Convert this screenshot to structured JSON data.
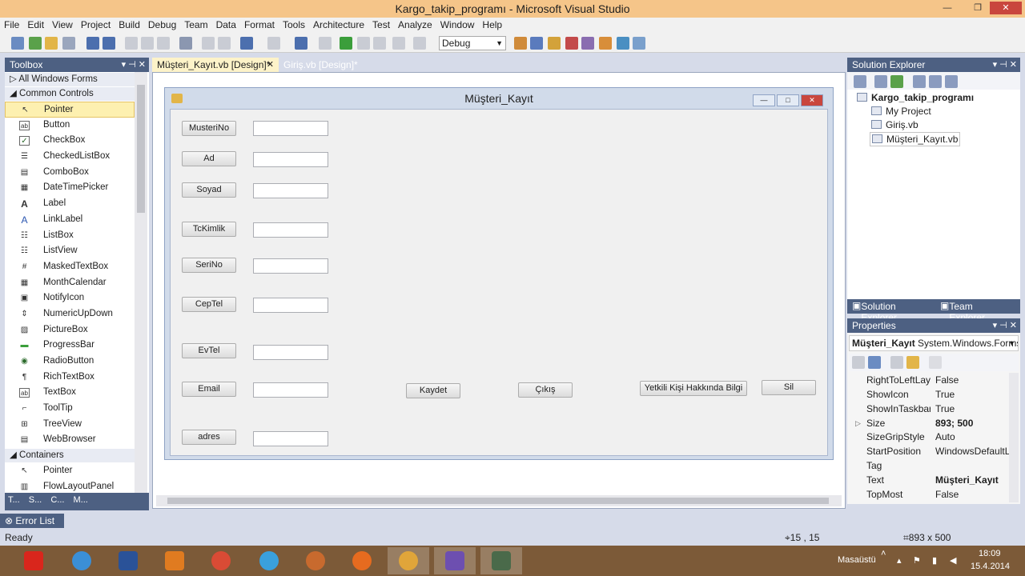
{
  "window": {
    "title": "Kargo_takip_programı - Microsoft Visual Studio"
  },
  "menu": [
    "File",
    "Edit",
    "View",
    "Project",
    "Build",
    "Debug",
    "Team",
    "Data",
    "Format",
    "Tools",
    "Architecture",
    "Test",
    "Analyze",
    "Window",
    "Help"
  ],
  "toolbar": {
    "config": "Debug"
  },
  "toolbox": {
    "title": "Toolbox",
    "categories": {
      "all": "All Windows Forms",
      "common": "Common Controls",
      "containers": "Containers"
    },
    "items": [
      "Pointer",
      "Button",
      "CheckBox",
      "CheckedListBox",
      "ComboBox",
      "DateTimePicker",
      "Label",
      "LinkLabel",
      "ListBox",
      "ListView",
      "MaskedTextBox",
      "MonthCalendar",
      "NotifyIcon",
      "NumericUpDown",
      "PictureBox",
      "ProgressBar",
      "RadioButton",
      "RichTextBox",
      "TextBox",
      "ToolTip",
      "TreeView",
      "WebBrowser"
    ],
    "container_items": [
      "Pointer",
      "FlowLayoutPanel"
    ],
    "tabs": [
      "T...",
      "S...",
      "C...",
      "M..."
    ]
  },
  "tabs": {
    "active": "Müşteri_Kayıt.vb [Design]*",
    "other": "Giriş.vb [Design]*"
  },
  "form": {
    "title": "Müşteri_Kayıt",
    "labels": [
      "MusteriNo",
      "Ad",
      "Soyad",
      "TcKimlik",
      "SeriNo",
      "CepTel",
      "EvTel",
      "Email",
      "adres"
    ],
    "buttons": {
      "kaydet": "Kaydet",
      "cikis": "Çıkış",
      "yetkili": "Yetkili Kişi Hakkında Bilgi",
      "sil": "Sil"
    }
  },
  "solution_explorer": {
    "title": "Solution Explorer",
    "project": "Kargo_takip_programı",
    "items": [
      "My Project",
      "Giriş.vb",
      "Müşteri_Kayıt.vb"
    ],
    "tabs": {
      "solution": "Solution Explorer",
      "team": "Team Explorer"
    }
  },
  "properties": {
    "title": "Properties",
    "object_name": "Müşteri_Kayıt",
    "object_type": "System.Windows.Forms.",
    "rows": [
      {
        "name": "RightToLeftLayc",
        "value": "False"
      },
      {
        "name": "ShowIcon",
        "value": "True"
      },
      {
        "name": "ShowInTaskbar",
        "value": "True"
      },
      {
        "name": "Size",
        "value": "893; 500"
      },
      {
        "name": "SizeGripStyle",
        "value": "Auto"
      },
      {
        "name": "StartPosition",
        "value": "WindowsDefaultLc"
      },
      {
        "name": "Tag",
        "value": ""
      },
      {
        "name": "Text",
        "value": "Müşteri_Kayıt"
      },
      {
        "name": "TopMost",
        "value": "False"
      }
    ]
  },
  "error_list": "Error List",
  "status": {
    "ready": "Ready",
    "position": "15 , 15",
    "size": "893 x 500"
  },
  "tray": {
    "location": "Masaüstü",
    "time": "18:09",
    "date": "15.4.2014"
  }
}
